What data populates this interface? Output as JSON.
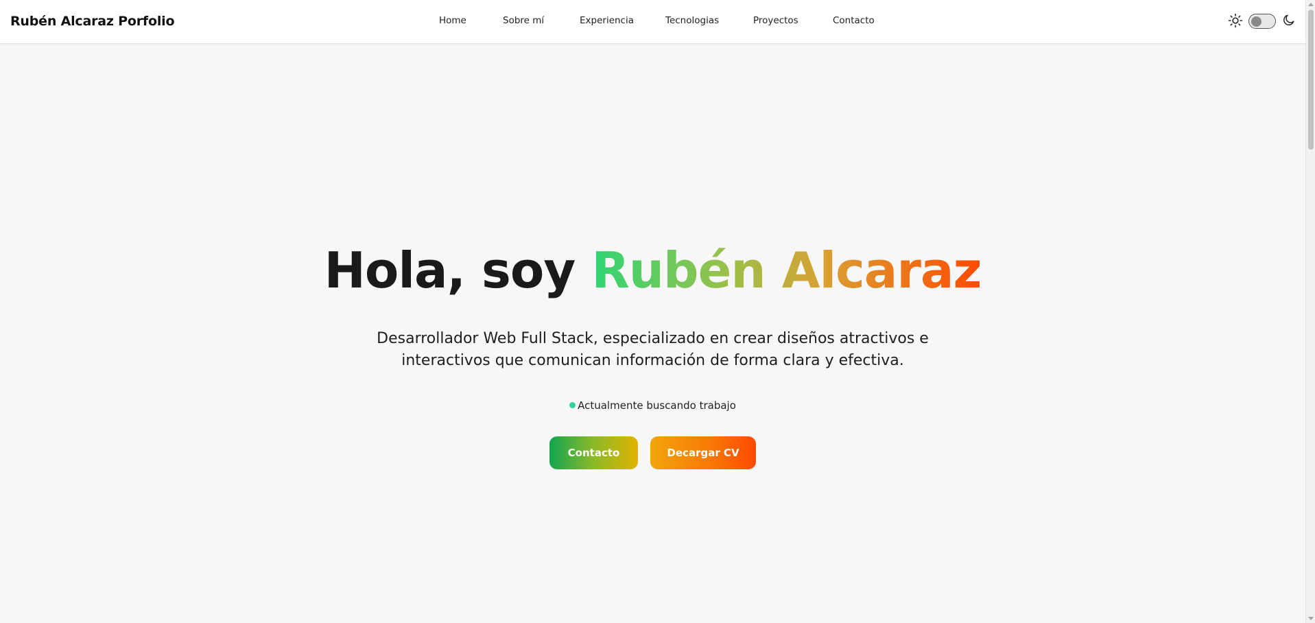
{
  "header": {
    "brand": "Rubén Alcaraz Porfolio",
    "nav": [
      "Home",
      "Sobre mí",
      "Experiencia",
      "Tecnologias",
      "Proyectos",
      "Contacto"
    ],
    "theme_toggle": {
      "light_icon": "sun-icon",
      "dark_icon": "moon-icon",
      "dark_mode": false
    }
  },
  "hero": {
    "greeting": "Hola, soy ",
    "name": "Rubén Alcaraz",
    "subtitle_line1": "Desarrollador Web Full Stack, especializado en crear diseños atractivos e",
    "subtitle_line2": "interactivos que comunican información de forma clara y efectiva.",
    "status": "Actualmente buscando trabajo",
    "buttons": {
      "contact": "Contacto",
      "cv": "Decargar CV"
    }
  },
  "colors": {
    "status_dot": "#34d399",
    "name_gradient": [
      "#2ed573",
      "#d9a032",
      "#ff4a00"
    ],
    "contact_gradient": [
      "#11a64f",
      "#e0b400"
    ],
    "cv_gradient": [
      "#f1a40a",
      "#ff4a00"
    ]
  }
}
